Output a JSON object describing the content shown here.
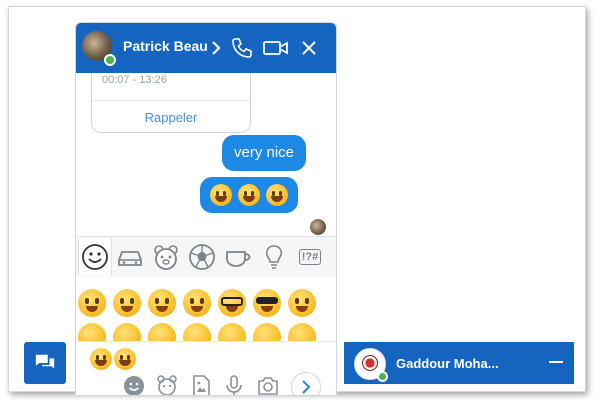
{
  "chat": {
    "contact_name": "Patrick Beau",
    "call_card": {
      "time": "00:07 - 13:26",
      "action": "Rappeler"
    },
    "messages": [
      {
        "text": "very nice"
      }
    ],
    "emoji_message": [
      "joy-emoji",
      "smiley-emoji",
      "smile-emoji"
    ]
  },
  "emoji_categories": [
    "smiley",
    "car",
    "animal",
    "soccer-ball",
    "cup",
    "lightbulb",
    "symbols"
  ],
  "symbols_label": "!?#",
  "compose": {
    "selected_emojis": [
      "hugging-emoji",
      "wink-tongue-emoji"
    ]
  },
  "minimized_chat": {
    "name": "Gaddour Moha..."
  },
  "colors": {
    "primary": "#1565c0",
    "bubble": "#1e88e5",
    "online": "#4caf50",
    "link": "#4a8fd6"
  }
}
